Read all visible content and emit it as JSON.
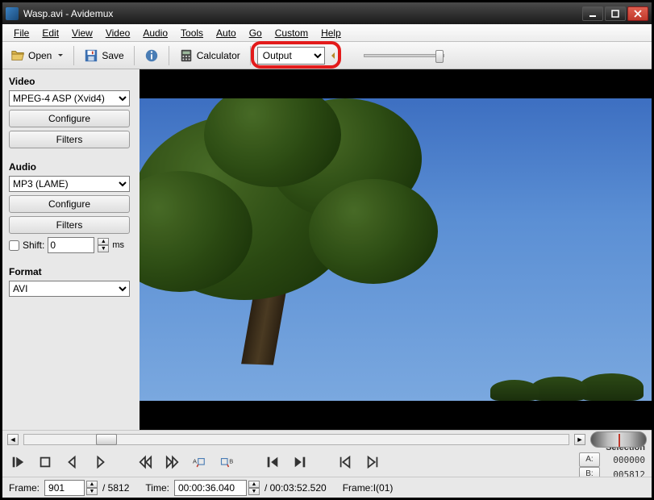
{
  "title": "Wasp.avi - Avidemux",
  "menu": {
    "file": "File",
    "edit": "Edit",
    "view": "View",
    "video": "Video",
    "audio": "Audio",
    "tools": "Tools",
    "auto": "Auto",
    "go": "Go",
    "custom": "Custom",
    "help": "Help"
  },
  "toolbar": {
    "open": "Open",
    "save": "Save",
    "calculator": "Calculator",
    "output": "Output"
  },
  "sidebar": {
    "video_label": "Video",
    "video_codec": "MPEG-4 ASP (Xvid4)",
    "configure": "Configure",
    "filters": "Filters",
    "audio_label": "Audio",
    "audio_codec": "MP3 (LAME)",
    "shift_label": "Shift:",
    "shift_value": "0",
    "ms": "ms",
    "format_label": "Format",
    "format_value": "AVI"
  },
  "transport": {
    "selection_label": "Selection",
    "a_label": "A:",
    "b_label": "B:",
    "a_value": "000000",
    "b_value": "005812"
  },
  "status": {
    "frame_label": "Frame:",
    "frame_value": "901",
    "frame_total": "/ 5812",
    "time_label": "Time:",
    "time_value": "00:00:36.040",
    "time_total": "/ 00:03:52.520",
    "frame_type": "Frame:I(01)"
  }
}
